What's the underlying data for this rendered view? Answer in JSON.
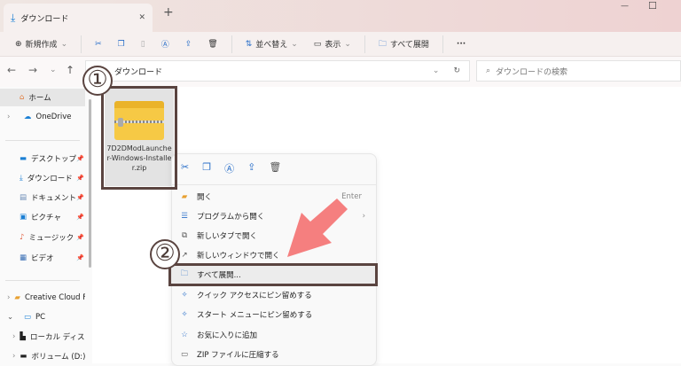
{
  "window": {
    "tab_title": "ダウンロード",
    "close_tab": "✕",
    "new_tab": "+",
    "minimize": "—",
    "maximize": "☐"
  },
  "toolbar": {
    "new": "新規作成",
    "sort": "並べ替え",
    "view": "表示",
    "extract_all": "すべて展開",
    "more": "···"
  },
  "address": {
    "path": "ダウンロード",
    "search_placeholder": "ダウンロードの検索"
  },
  "sidebar": {
    "items": [
      {
        "label": "ホーム"
      },
      {
        "label": "OneDrive"
      },
      {
        "label": "デスクトップ"
      },
      {
        "label": "ダウンロード"
      },
      {
        "label": "ドキュメント"
      },
      {
        "label": "ピクチャ"
      },
      {
        "label": "ミュージック"
      },
      {
        "label": "ビデオ"
      },
      {
        "label": "Creative Cloud F"
      },
      {
        "label": "PC"
      },
      {
        "label": "ローカル ディスク"
      },
      {
        "label": "ボリューム (D:)"
      }
    ]
  },
  "file": {
    "name": "7D2DModLauncher-Windows-Installer.zip"
  },
  "context_menu": {
    "items": [
      {
        "label": "開く",
        "shortcut": "Enter"
      },
      {
        "label": "プログラムから開く"
      },
      {
        "label": "新しいタブで開く"
      },
      {
        "label": "新しいウィンドウで開く"
      },
      {
        "label": "すべて展開..."
      },
      {
        "label": "クイック アクセスにピン留めする"
      },
      {
        "label": "スタート メニューにピン留めする"
      },
      {
        "label": "お気に入りに追加"
      },
      {
        "label": "ZIP ファイルに圧縮する"
      }
    ]
  },
  "annotations": {
    "step1": "①",
    "step2": "②",
    "color": "#5a4440",
    "arrow_color": "#f47878"
  }
}
